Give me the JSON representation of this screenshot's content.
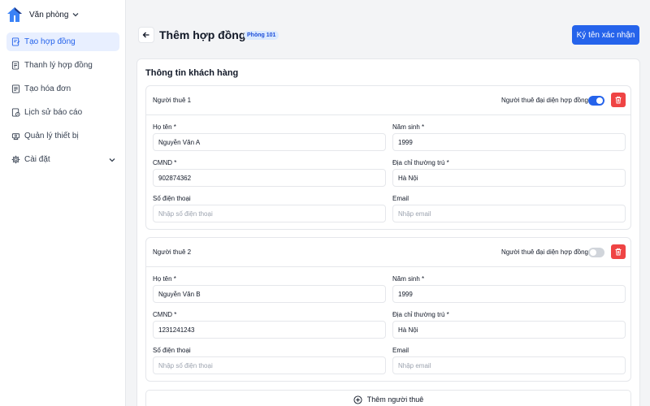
{
  "sidebar": {
    "workspace": "Văn phòng",
    "items": [
      {
        "label": "Tạo hợp đồng",
        "icon": "contract-icon"
      },
      {
        "label": "Thanh lý hợp đồng",
        "icon": "contract-end-icon"
      },
      {
        "label": "Tạo hóa đơn",
        "icon": "invoice-icon"
      },
      {
        "label": "Lịch sử báo cáo",
        "icon": "report-history-icon"
      },
      {
        "label": "Quản lý thiết bị",
        "icon": "device-icon"
      },
      {
        "label": "Cài đặt",
        "icon": "gear-icon"
      }
    ]
  },
  "header": {
    "title": "Thêm hợp đồng",
    "room_badge": "Phòng 101",
    "sign_label": "Ký tên xác nhận"
  },
  "section": {
    "title": "Thông tin khách hàng"
  },
  "tenants": [
    {
      "name": "Người thuê 1",
      "rep_label": "Người thuê đại diện hợp đồng",
      "rep_on": true,
      "fullname_label": "Họ tên *",
      "fullname": "Nguyễn Văn A",
      "birth_label": "Năm sinh *",
      "birth": "1999",
      "id_label": "CMND *",
      "id": "902874362",
      "address_label": "Địa chỉ thường trú *",
      "address": "Hà Nội",
      "phone_label": "Số điện thoại",
      "phone_placeholder": "Nhập số điện thoại",
      "email_label": "Email",
      "email_placeholder": "Nhập email"
    },
    {
      "name": "Người thuê 2",
      "rep_label": "Người thuê đại diện hợp đồng",
      "rep_on": false,
      "fullname_label": "Họ tên *",
      "fullname": "Nguyễn Văn B",
      "birth_label": "Năm sinh *",
      "birth": "1999",
      "id_label": "CMND *",
      "id": "1231241243",
      "address_label": "Địa chỉ thường trú *",
      "address": "Hà Nội",
      "phone_label": "Số điện thoại",
      "phone_placeholder": "Nhập số điện thoại",
      "email_label": "Email",
      "email_placeholder": "Nhập email"
    }
  ],
  "add_tenant_label": "Thêm người thuê",
  "colors": {
    "accent": "#2563eb",
    "danger": "#ef4444",
    "active_bg": "#e8efff"
  }
}
